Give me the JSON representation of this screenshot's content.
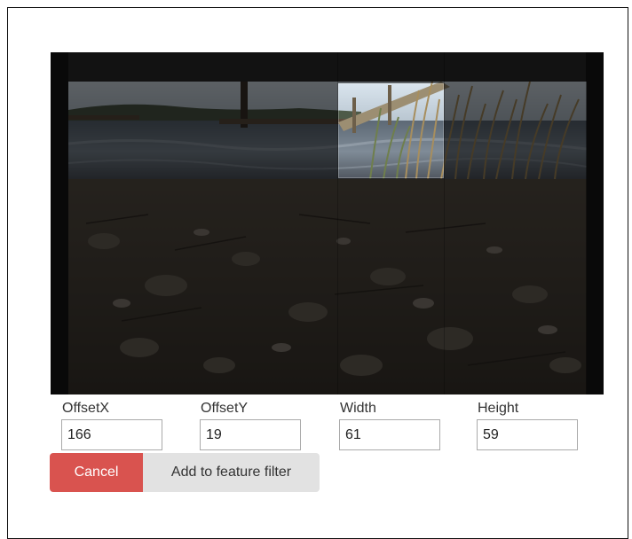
{
  "form": {
    "fields": [
      {
        "label": "OffsetX",
        "value": "166"
      },
      {
        "label": "OffsetY",
        "value": "19"
      },
      {
        "label": "Width",
        "value": "61"
      },
      {
        "label": "Height",
        "value": "59"
      }
    ]
  },
  "buttons": {
    "cancel_label": "Cancel",
    "add_label": "Add to feature filter"
  },
  "colors": {
    "cancel": "#d9534f",
    "add": "#e2e2e2"
  }
}
